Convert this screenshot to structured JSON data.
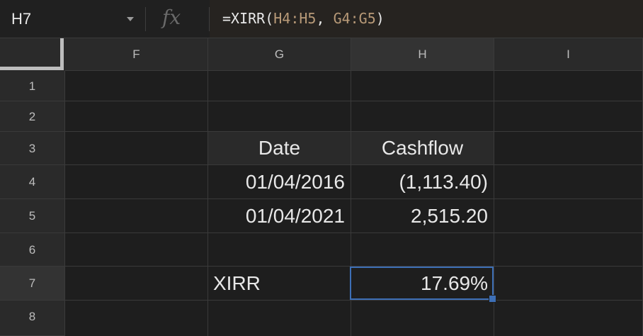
{
  "formula_bar": {
    "name_box": "H7",
    "fx_label": "fx",
    "formula_prefix": "=XIRR(",
    "formula_arg1": "H4:H5",
    "formula_comma": ", ",
    "formula_arg2": "G4:G5",
    "formula_suffix": ")"
  },
  "columns": [
    "F",
    "G",
    "H",
    "I"
  ],
  "rows": [
    "1",
    "2",
    "3",
    "4",
    "5",
    "6",
    "7",
    "8"
  ],
  "cells": {
    "G3": "Date",
    "H3": "Cashflow",
    "G4": "01/04/2016",
    "H4": "(1,113.40)",
    "G5": "01/04/2021",
    "H5": "2,515.20",
    "G7": "XIRR",
    "H7": "17.69%"
  },
  "colors": {
    "background": "#1e1e1e",
    "selection": "#3d6fb6",
    "formula_arg": "#b89a78"
  },
  "selected_cell": "H7"
}
